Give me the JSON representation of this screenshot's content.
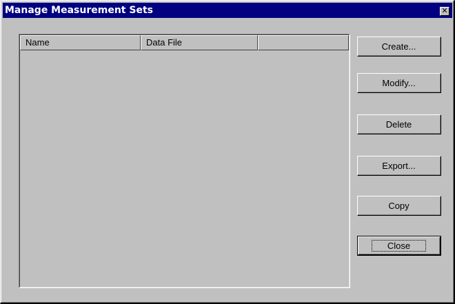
{
  "window": {
    "title": "Manage Measurement Sets",
    "close_glyph": "✕",
    "colors": {
      "titlebar": "#000080",
      "title_text": "#ffffff",
      "face": "#c0c0c0"
    }
  },
  "list": {
    "columns": [
      {
        "label": "Name"
      },
      {
        "label": "Data File"
      },
      {
        "label": ""
      }
    ],
    "rows": []
  },
  "buttons": {
    "create": "Create...",
    "modify": "Modify...",
    "delete": "Delete",
    "export": "Export...",
    "copy": "Copy",
    "close": "Close"
  },
  "icons": {
    "close": "close-icon"
  }
}
